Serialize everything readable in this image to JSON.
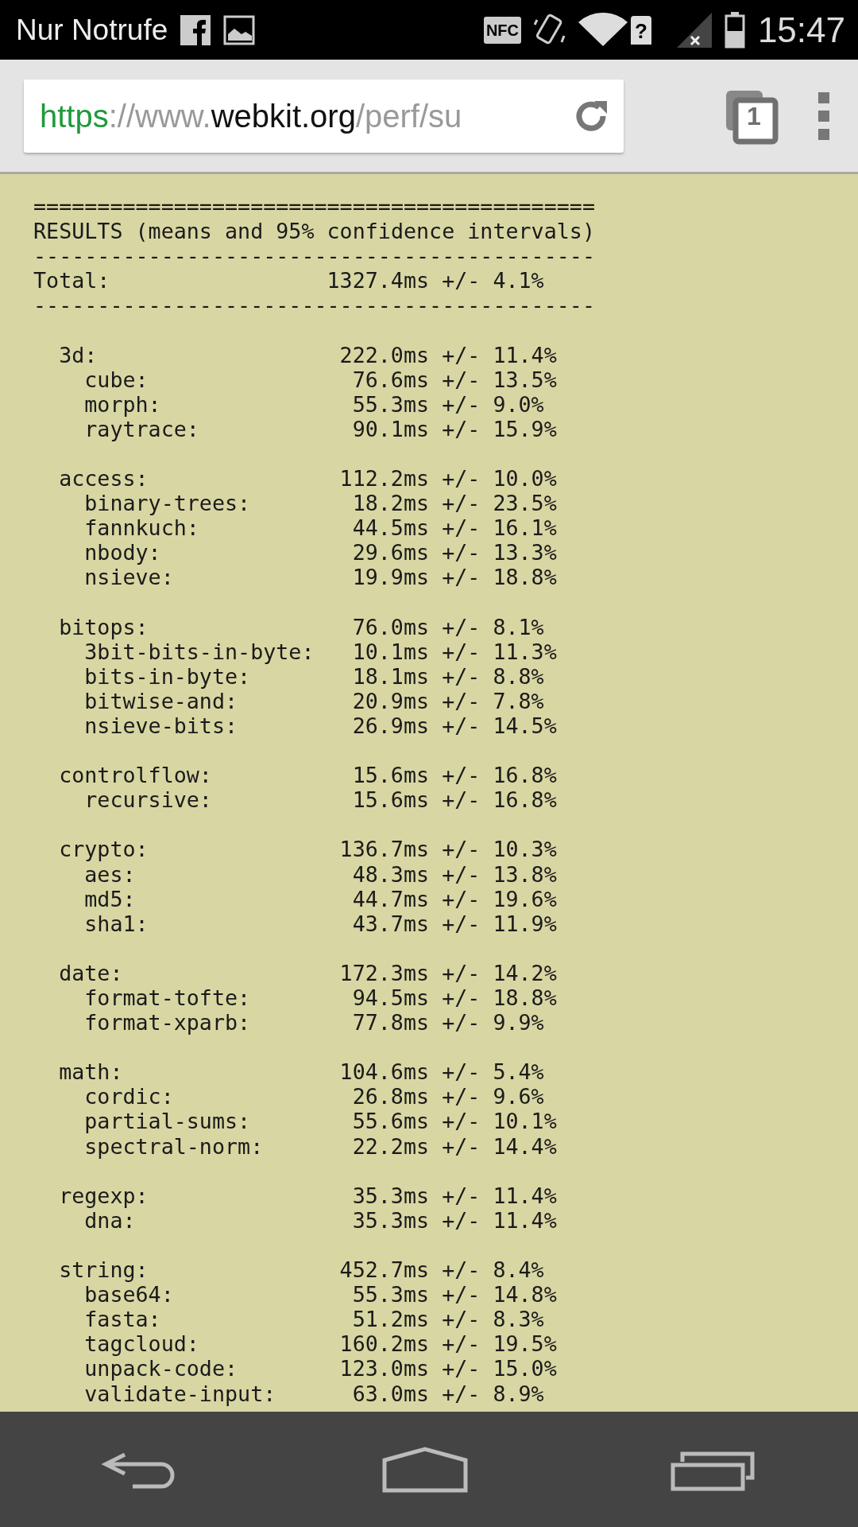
{
  "status_bar": {
    "carrier": "Nur Notrufe",
    "nfc": "NFC",
    "wifi_status": "?",
    "time": "15:47"
  },
  "browser": {
    "url": {
      "scheme": "https",
      "separator": "://www.",
      "domain": "webkit.org",
      "path": "/perf/su"
    },
    "tab_count": "1"
  },
  "results": {
    "top_rule": "============================================",
    "title": "RESULTS (means and 95% confidence intervals)",
    "rule": "--------------------------------------------",
    "total": {
      "label": "Total:",
      "time": "1327.4ms",
      "ci": "+/- 4.1%"
    },
    "bottom_rule": "--------------------------------------------",
    "groups": [
      {
        "label": "3d:",
        "time": "222.0ms",
        "ci": "+/- 11.4%",
        "children": [
          {
            "label": "cube:",
            "time": "76.6ms",
            "ci": "+/- 13.5%"
          },
          {
            "label": "morph:",
            "time": "55.3ms",
            "ci": "+/- 9.0%"
          },
          {
            "label": "raytrace:",
            "time": "90.1ms",
            "ci": "+/- 15.9%"
          }
        ]
      },
      {
        "label": "access:",
        "time": "112.2ms",
        "ci": "+/- 10.0%",
        "children": [
          {
            "label": "binary-trees:",
            "time": "18.2ms",
            "ci": "+/- 23.5%"
          },
          {
            "label": "fannkuch:",
            "time": "44.5ms",
            "ci": "+/- 16.1%"
          },
          {
            "label": "nbody:",
            "time": "29.6ms",
            "ci": "+/- 13.3%"
          },
          {
            "label": "nsieve:",
            "time": "19.9ms",
            "ci": "+/- 18.8%"
          }
        ]
      },
      {
        "label": "bitops:",
        "time": "76.0ms",
        "ci": "+/- 8.1%",
        "children": [
          {
            "label": "3bit-bits-in-byte:",
            "time": "10.1ms",
            "ci": "+/- 11.3%"
          },
          {
            "label": "bits-in-byte:",
            "time": "18.1ms",
            "ci": "+/- 8.8%"
          },
          {
            "label": "bitwise-and:",
            "time": "20.9ms",
            "ci": "+/- 7.8%"
          },
          {
            "label": "nsieve-bits:",
            "time": "26.9ms",
            "ci": "+/- 14.5%"
          }
        ]
      },
      {
        "label": "controlflow:",
        "time": "15.6ms",
        "ci": "+/- 16.8%",
        "children": [
          {
            "label": "recursive:",
            "time": "15.6ms",
            "ci": "+/- 16.8%"
          }
        ]
      },
      {
        "label": "crypto:",
        "time": "136.7ms",
        "ci": "+/- 10.3%",
        "children": [
          {
            "label": "aes:",
            "time": "48.3ms",
            "ci": "+/- 13.8%"
          },
          {
            "label": "md5:",
            "time": "44.7ms",
            "ci": "+/- 19.6%"
          },
          {
            "label": "sha1:",
            "time": "43.7ms",
            "ci": "+/- 11.9%"
          }
        ]
      },
      {
        "label": "date:",
        "time": "172.3ms",
        "ci": "+/- 14.2%",
        "children": [
          {
            "label": "format-tofte:",
            "time": "94.5ms",
            "ci": "+/- 18.8%"
          },
          {
            "label": "format-xparb:",
            "time": "77.8ms",
            "ci": "+/- 9.9%"
          }
        ]
      },
      {
        "label": "math:",
        "time": "104.6ms",
        "ci": "+/- 5.4%",
        "children": [
          {
            "label": "cordic:",
            "time": "26.8ms",
            "ci": "+/- 9.6%"
          },
          {
            "label": "partial-sums:",
            "time": "55.6ms",
            "ci": "+/- 10.1%"
          },
          {
            "label": "spectral-norm:",
            "time": "22.2ms",
            "ci": "+/- 14.4%"
          }
        ]
      },
      {
        "label": "regexp:",
        "time": "35.3ms",
        "ci": "+/- 11.4%",
        "children": [
          {
            "label": "dna:",
            "time": "35.3ms",
            "ci": "+/- 11.4%"
          }
        ]
      },
      {
        "label": "string:",
        "time": "452.7ms",
        "ci": "+/- 8.4%",
        "children": [
          {
            "label": "base64:",
            "time": "55.3ms",
            "ci": "+/- 14.8%"
          },
          {
            "label": "fasta:",
            "time": "51.2ms",
            "ci": "+/- 8.3%"
          },
          {
            "label": "tagcloud:",
            "time": "160.2ms",
            "ci": "+/- 19.5%"
          },
          {
            "label": "unpack-code:",
            "time": "123.0ms",
            "ci": "+/- 15.0%"
          },
          {
            "label": "validate-input:",
            "time": "63.0ms",
            "ci": "+/- 8.9%"
          }
        ]
      }
    ]
  }
}
